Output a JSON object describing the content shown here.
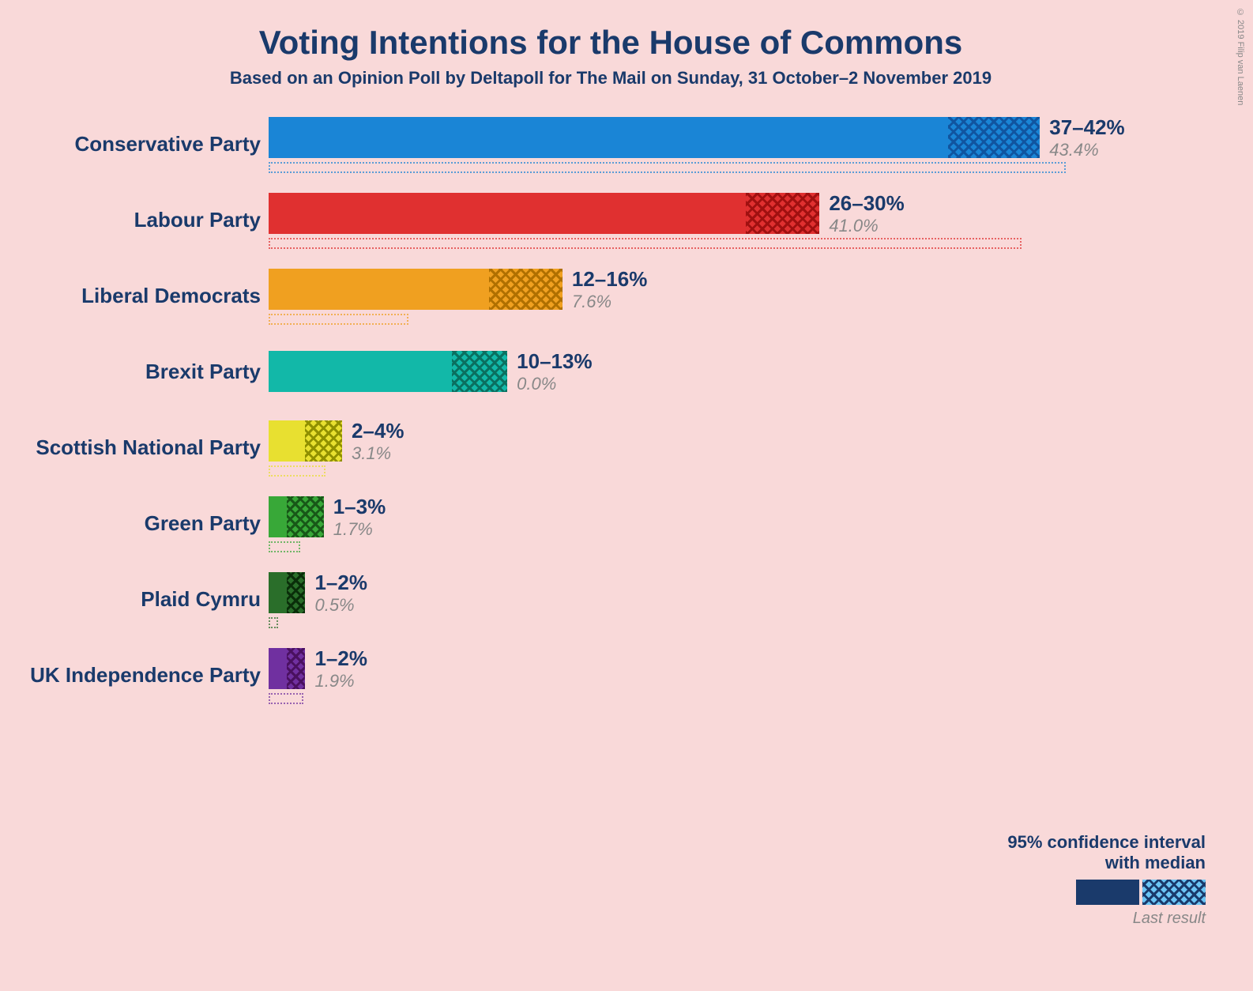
{
  "title": "Voting Intentions for the House of Commons",
  "subtitle": "Based on an Opinion Poll by Deltapoll for The Mail on Sunday, 31 October–2 November 2019",
  "copyright": "© 2019 Filip van Laenen",
  "maxPct": 45,
  "parties": [
    {
      "name": "Conservative Party",
      "color": "#1a85d6",
      "rangeLow": 37,
      "rangeHigh": 42,
      "lastResult": 43.4,
      "rangeLabel": "37–42%",
      "lastLabel": "43.4%",
      "hatchColor": "#1055a0"
    },
    {
      "name": "Labour Party",
      "color": "#e03030",
      "rangeLow": 26,
      "rangeHigh": 30,
      "lastResult": 41.0,
      "rangeLabel": "26–30%",
      "lastLabel": "41.0%",
      "hatchColor": "#a01010"
    },
    {
      "name": "Liberal Democrats",
      "color": "#f0a020",
      "rangeLow": 12,
      "rangeHigh": 16,
      "lastResult": 7.6,
      "rangeLabel": "12–16%",
      "lastLabel": "7.6%",
      "hatchColor": "#b07000"
    },
    {
      "name": "Brexit Party",
      "color": "#12b8a8",
      "rangeLow": 10,
      "rangeHigh": 13,
      "lastResult": 0.0,
      "rangeLabel": "10–13%",
      "lastLabel": "0.0%",
      "hatchColor": "#0a7060"
    },
    {
      "name": "Scottish National Party",
      "color": "#e8e030",
      "rangeLow": 2,
      "rangeHigh": 4,
      "lastResult": 3.1,
      "rangeLabel": "2–4%",
      "lastLabel": "3.1%",
      "hatchColor": "#909000"
    },
    {
      "name": "Green Party",
      "color": "#38a838",
      "rangeLow": 1,
      "rangeHigh": 3,
      "lastResult": 1.7,
      "rangeLabel": "1–3%",
      "lastLabel": "1.7%",
      "hatchColor": "#185818"
    },
    {
      "name": "Plaid Cymru",
      "color": "#2a6e2a",
      "rangeLow": 1,
      "rangeHigh": 2,
      "lastResult": 0.5,
      "rangeLabel": "1–2%",
      "lastLabel": "0.5%",
      "hatchColor": "#0a2e0a"
    },
    {
      "name": "UK Independence Party",
      "color": "#7030a0",
      "rangeLow": 1,
      "rangeHigh": 2,
      "lastResult": 1.9,
      "rangeLabel": "1–2%",
      "lastLabel": "1.9%",
      "hatchColor": "#4a1060"
    }
  ],
  "legend": {
    "confidenceTitle": "95% confidence interval",
    "confidenceTitle2": "with median",
    "lastResultLabel": "Last result"
  }
}
